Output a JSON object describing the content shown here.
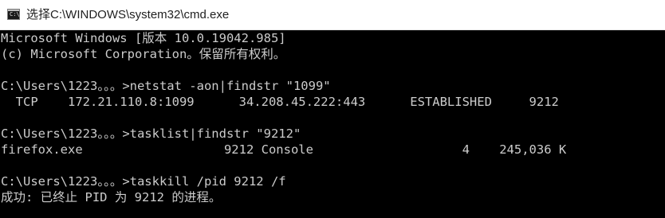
{
  "window": {
    "title": "选择C:\\WINDOWS\\system32\\cmd.exe",
    "icon": "cmd-icon",
    "icon_glyph": "C:\\",
    "colors": {
      "console_bg": "#000000",
      "console_text": "#cccccc",
      "titlebar_bg": "#ffffff"
    }
  },
  "console": {
    "lines": [
      "Microsoft Windows [版本 10.0.19042.985]",
      "(c) Microsoft Corporation。保留所有权利。",
      "",
      "C:\\Users\\1223。。。>netstat -aon|findstr \"1099\"",
      "  TCP    172.21.110.8:1099      34.208.45.222:443      ESTABLISHED     9212",
      "",
      "C:\\Users\\1223。。。>tasklist|findstr \"9212\"",
      "firefox.exe                   9212 Console                    4    245,036 K",
      "",
      "C:\\Users\\1223。。。>taskkill /pid 9212 /f",
      "成功: 已终止 PID 为 9212 的进程。"
    ]
  }
}
